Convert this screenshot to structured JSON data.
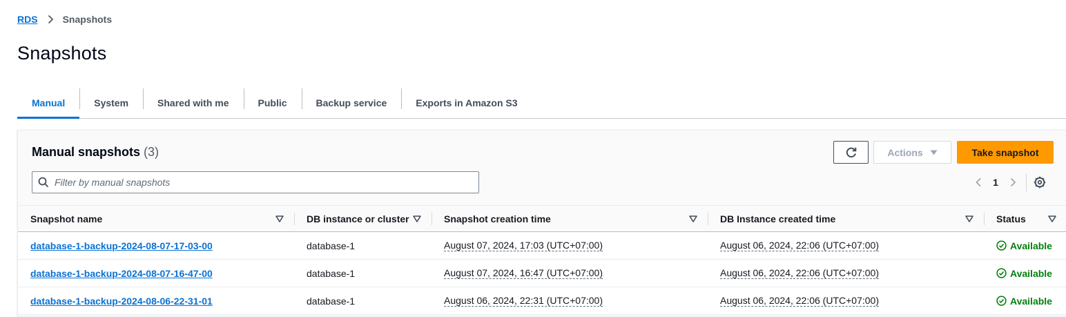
{
  "breadcrumb": {
    "root": "RDS",
    "current": "Snapshots"
  },
  "page_title": "Snapshots",
  "tabs": [
    {
      "label": "Manual",
      "active": true
    },
    {
      "label": "System",
      "active": false
    },
    {
      "label": "Shared with me",
      "active": false
    },
    {
      "label": "Public",
      "active": false
    },
    {
      "label": "Backup service",
      "active": false
    },
    {
      "label": "Exports in Amazon S3",
      "active": false
    }
  ],
  "panel": {
    "title": "Manual snapshots",
    "count": "(3)",
    "actions_label": "Actions",
    "primary_label": "Take snapshot",
    "search_placeholder": "Filter by manual snapshots",
    "page_number": "1"
  },
  "table": {
    "columns": [
      "Snapshot name",
      "DB instance or cluster",
      "Snapshot creation time",
      "DB Instance created time",
      "Status"
    ],
    "rows": [
      {
        "name": "database-1-backup-2024-08-07-17-03-00",
        "instance": "database-1",
        "created": "August 07, 2024, 17:03 (UTC+07:00)",
        "instance_created": "August 06, 2024, 22:06 (UTC+07:00)",
        "status": "Available"
      },
      {
        "name": "database-1-backup-2024-08-07-16-47-00",
        "instance": "database-1",
        "created": "August 07, 2024, 16:47 (UTC+07:00)",
        "instance_created": "August 06, 2024, 22:06 (UTC+07:00)",
        "status": "Available"
      },
      {
        "name": "database-1-backup-2024-08-06-22-31-01",
        "instance": "database-1",
        "created": "August 06, 2024, 22:31 (UTC+07:00)",
        "instance_created": "August 06, 2024, 22:06 (UTC+07:00)",
        "status": "Available"
      }
    ]
  },
  "colors": {
    "link": "#0972d3",
    "primary": "#ff9900",
    "success": "#037f0c"
  },
  "icons": {
    "refresh": "refresh-icon",
    "search": "search-icon",
    "settings": "gear-icon",
    "status": "check-circle-icon"
  }
}
